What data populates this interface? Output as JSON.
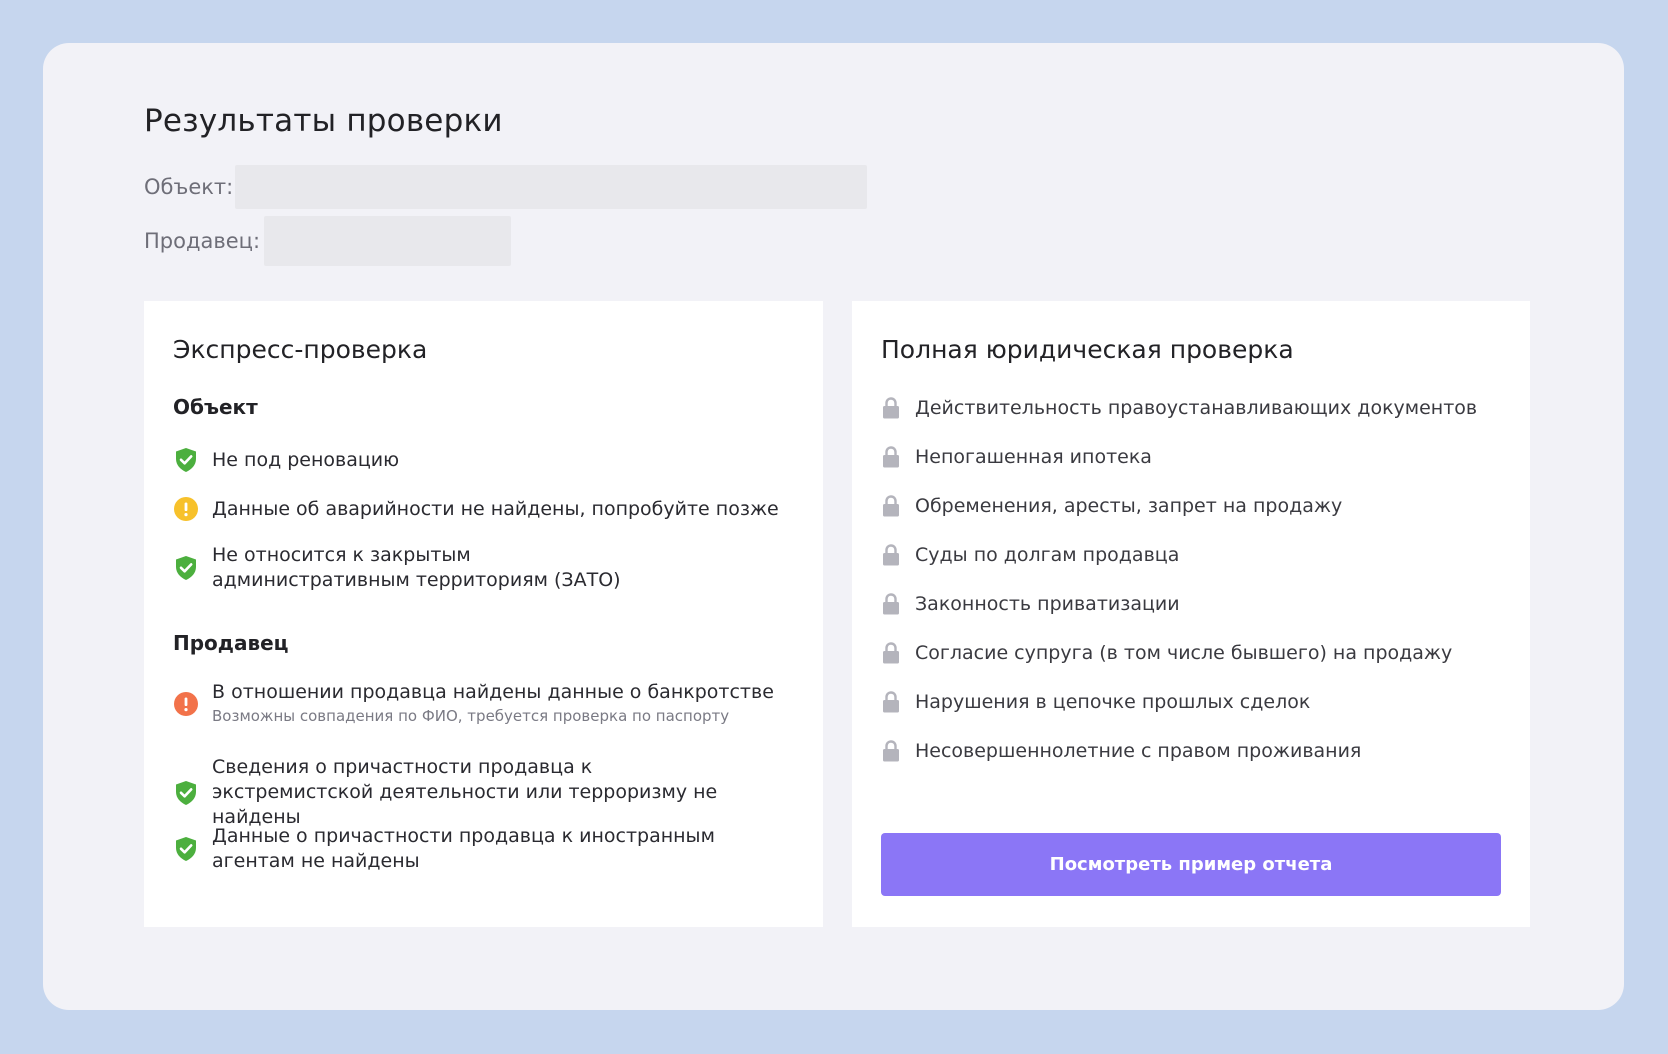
{
  "page": {
    "title": "Результаты проверки",
    "object_label": "Объект:",
    "seller_label": "Продавец:"
  },
  "express": {
    "title": "Экспресс-проверка",
    "object_section": "Объект",
    "object_items": [
      {
        "status": "ok",
        "text": "Не под реновацию"
      },
      {
        "status": "warning",
        "text": "Данные об аварийности не найдены, попробуйте позже"
      },
      {
        "status": "ok",
        "text": "Не относится к закрытым административным территориям (ЗАТО)"
      }
    ],
    "seller_section": "Продавец",
    "seller_items": [
      {
        "status": "alert",
        "text": "В отношении продавца найдены данные о банкротстве",
        "sub": "Возможны совпадения по ФИО, требуется проверка по паспорту"
      },
      {
        "status": "ok",
        "text": "Сведения о причастности продавца к экстремистской деятельности или терроризму не найдены"
      },
      {
        "status": "ok",
        "text": "Данные о причастности продавца к иностранным агентам не найдены"
      }
    ]
  },
  "full": {
    "title": "Полная юридическая проверка",
    "items": [
      "Действительность правоустанавливающих документов",
      "Непогашенная ипотека",
      "Обременения, аресты, запрет на продажу",
      "Суды по долгам продавца",
      "Законность приватизации",
      "Согласие супруга (в том числе бывшего) на продажу",
      "Нарушения в цепочке прошлых сделок",
      "Несовершеннолетние с правом проживания"
    ],
    "cta_label": "Посмотреть пример отчета"
  },
  "colors": {
    "background": "#c6d6ee",
    "panel": "#f2f2f7",
    "ok": "#4caf3e",
    "warning": "#f7c12b",
    "alert": "#f2724a",
    "lock": "#b4b4bc",
    "accent": "#8b76f6"
  },
  "icons": {
    "ok": "shield-check-icon",
    "warning": "exclamation-circle-icon",
    "alert": "exclamation-circle-icon",
    "locked": "lock-icon"
  }
}
